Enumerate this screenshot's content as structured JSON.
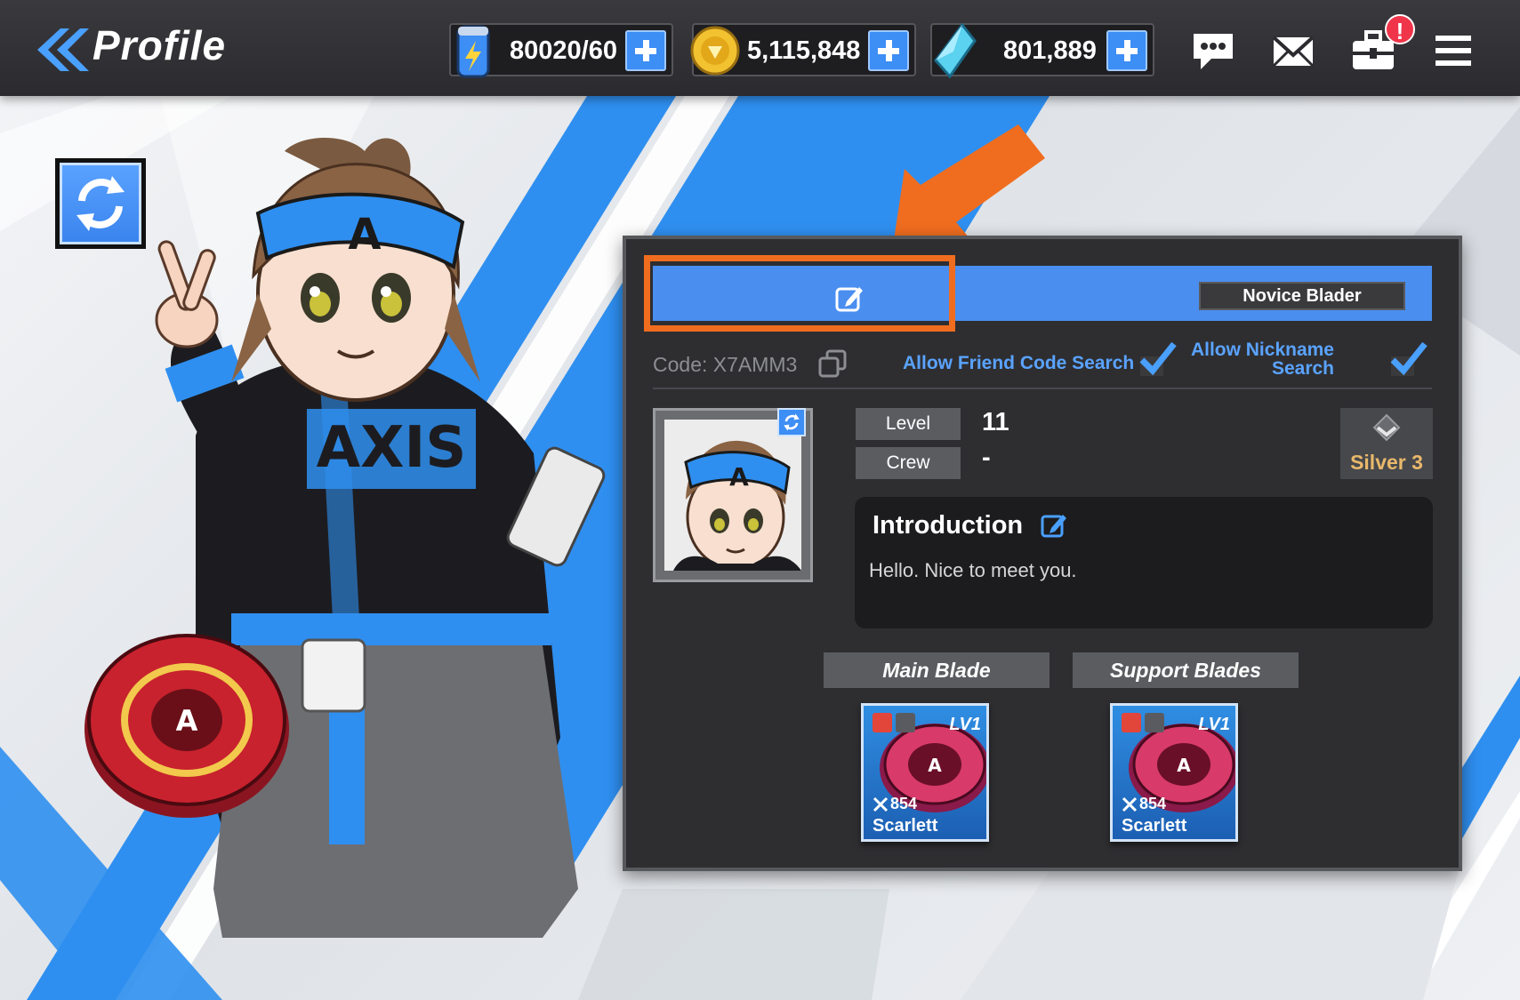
{
  "header": {
    "title": "Profile",
    "currencies": [
      {
        "icon": "energy-can-icon",
        "value": "80020/60"
      },
      {
        "icon": "gold-coin-icon",
        "value": "5,115,848"
      },
      {
        "icon": "crystal-gem-icon",
        "value": "801,889"
      }
    ],
    "notification_badge": "!"
  },
  "profile": {
    "title_badge": "Novice Blader",
    "code": "Code: X7AMM3",
    "allow_friend_code_search": "Allow Friend Code Search",
    "allow_nickname_search": "Allow Nickname Search",
    "level_label": "Level",
    "level_value": "11",
    "crew_label": "Crew",
    "crew_value": "-",
    "rank": "Silver 3",
    "introduction_title": "Introduction",
    "introduction_text": "Hello. Nice to meet you.",
    "main_blade_label": "Main Blade",
    "support_blades_label": "Support Blades",
    "main_blade": {
      "level": "LV1",
      "power": "854",
      "name": "Scarlett"
    },
    "support_blade": {
      "level": "LV1",
      "power": "854",
      "name": "Scarlett"
    }
  },
  "colors": {
    "accent_blue": "#4a8ef0",
    "highlight_orange": "#f06d1f",
    "rank_gold": "#e8b86b",
    "link_blue": "#5aa3ff"
  }
}
